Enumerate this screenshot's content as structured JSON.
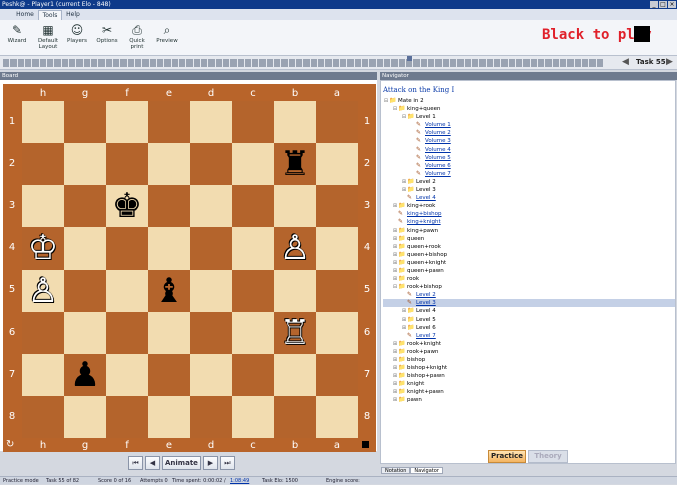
{
  "window": {
    "title": "Peshk@ - Player1 (current Elo - 848)"
  },
  "ribbon_tabs": [
    "Home",
    "Tools",
    "Help"
  ],
  "ribbon_buttons": [
    {
      "label": "Wizard",
      "icon": "wizard-icon"
    },
    {
      "label": "Default Layout",
      "icon": "default-layout-icon"
    },
    {
      "label": "Players",
      "icon": "players-icon"
    },
    {
      "label": "Options",
      "icon": "options-icon"
    },
    {
      "label": "Quick print",
      "icon": "quick-print-icon"
    },
    {
      "label": "Preview",
      "icon": "preview-icon"
    }
  ],
  "to_move": {
    "text": "Black to play",
    "color": "#000000"
  },
  "task": {
    "label": "Task 55"
  },
  "board": {
    "panel_title": "Board",
    "files": [
      "h",
      "g",
      "f",
      "e",
      "d",
      "c",
      "b",
      "a"
    ],
    "ranks": [
      "1",
      "2",
      "3",
      "4",
      "5",
      "6",
      "7",
      "8"
    ],
    "pieces": [
      {
        "square": "b2",
        "type": "rook",
        "color": "black",
        "glyph": "♜"
      },
      {
        "square": "f3",
        "type": "king",
        "color": "black",
        "glyph": "♚"
      },
      {
        "square": "h4",
        "type": "king",
        "color": "white",
        "glyph": "♔"
      },
      {
        "square": "b4",
        "type": "pawn",
        "color": "white",
        "glyph": "♙"
      },
      {
        "square": "h5",
        "type": "pawn",
        "color": "white",
        "glyph": "♙"
      },
      {
        "square": "e5",
        "type": "bishop",
        "color": "black",
        "glyph": "♝"
      },
      {
        "square": "b6",
        "type": "rook",
        "color": "white",
        "glyph": "♖"
      },
      {
        "square": "g7",
        "type": "pawn",
        "color": "black",
        "glyph": "♟"
      }
    ],
    "light_color": "#f2dcb0",
    "dark_color": "#b4642c",
    "controls": {
      "first": "⏮",
      "prev": "◀",
      "animate": "Animate",
      "next": "▶",
      "last": "⏭"
    }
  },
  "navigator": {
    "panel_title": "Navigator",
    "title": "Attack on the King I",
    "tree": [
      {
        "label": "Mate in 2",
        "depth": 0,
        "expander": "⊟",
        "icon": "folder"
      },
      {
        "label": "king+queen",
        "depth": 1,
        "expander": "⊟",
        "icon": "folder"
      },
      {
        "label": "Level 1",
        "depth": 2,
        "expander": "⊟",
        "icon": "folder"
      },
      {
        "label": "Volume 1",
        "depth": 3,
        "expander": "",
        "icon": "task",
        "link": true
      },
      {
        "label": "Volume 2",
        "depth": 3,
        "expander": "",
        "icon": "task",
        "link": true
      },
      {
        "label": "Volume 3",
        "depth": 3,
        "expander": "",
        "icon": "task",
        "link": true
      },
      {
        "label": "Volume 4",
        "depth": 3,
        "expander": "",
        "icon": "task",
        "link": true
      },
      {
        "label": "Volume 5",
        "depth": 3,
        "expander": "",
        "icon": "task",
        "link": true
      },
      {
        "label": "Volume 6",
        "depth": 3,
        "expander": "",
        "icon": "task",
        "link": true
      },
      {
        "label": "Volume 7",
        "depth": 3,
        "expander": "",
        "icon": "task",
        "link": true
      },
      {
        "label": "Level 2",
        "depth": 2,
        "expander": "⊞",
        "icon": "folder"
      },
      {
        "label": "Level 3",
        "depth": 2,
        "expander": "⊞",
        "icon": "folder"
      },
      {
        "label": "Level 4",
        "depth": 2,
        "expander": "",
        "icon": "task",
        "link": true
      },
      {
        "label": "king+rook",
        "depth": 1,
        "expander": "⊞",
        "icon": "folder"
      },
      {
        "label": "king+bishop",
        "depth": 1,
        "expander": "",
        "icon": "task",
        "link": true
      },
      {
        "label": "king+knight",
        "depth": 1,
        "expander": "",
        "icon": "task",
        "link": true
      },
      {
        "label": "king+pawn",
        "depth": 1,
        "expander": "⊞",
        "icon": "folder"
      },
      {
        "label": "queen",
        "depth": 1,
        "expander": "⊞",
        "icon": "folder"
      },
      {
        "label": "queen+rook",
        "depth": 1,
        "expander": "⊞",
        "icon": "folder"
      },
      {
        "label": "queen+bishop",
        "depth": 1,
        "expander": "⊞",
        "icon": "folder"
      },
      {
        "label": "queen+knight",
        "depth": 1,
        "expander": "⊞",
        "icon": "folder"
      },
      {
        "label": "queen+pawn",
        "depth": 1,
        "expander": "⊞",
        "icon": "folder"
      },
      {
        "label": "rook",
        "depth": 1,
        "expander": "⊞",
        "icon": "folder"
      },
      {
        "label": "rook+bishop",
        "depth": 1,
        "expander": "⊟",
        "icon": "folder"
      },
      {
        "label": "Level 2",
        "depth": 2,
        "expander": "",
        "icon": "task",
        "link": true
      },
      {
        "label": "Level 3",
        "depth": 2,
        "expander": "",
        "icon": "task",
        "link": true,
        "selected": true
      },
      {
        "label": "Level 4",
        "depth": 2,
        "expander": "⊞",
        "icon": "folder"
      },
      {
        "label": "Level 5",
        "depth": 2,
        "expander": "⊞",
        "icon": "folder"
      },
      {
        "label": "Level 6",
        "depth": 2,
        "expander": "⊞",
        "icon": "folder"
      },
      {
        "label": "Level 7",
        "depth": 2,
        "expander": "",
        "icon": "task",
        "link": true
      },
      {
        "label": "rook+knight",
        "depth": 1,
        "expander": "⊞",
        "icon": "folder"
      },
      {
        "label": "rook+pawn",
        "depth": 1,
        "expander": "⊞",
        "icon": "folder"
      },
      {
        "label": "bishop",
        "depth": 1,
        "expander": "⊞",
        "icon": "folder"
      },
      {
        "label": "bishop+knight",
        "depth": 1,
        "expander": "⊞",
        "icon": "folder"
      },
      {
        "label": "bishop+pawn",
        "depth": 1,
        "expander": "⊞",
        "icon": "folder"
      },
      {
        "label": "knight",
        "depth": 1,
        "expander": "⊞",
        "icon": "folder"
      },
      {
        "label": "knight+pawn",
        "depth": 1,
        "expander": "⊞",
        "icon": "folder"
      },
      {
        "label": "pawn",
        "depth": 1,
        "expander": "⊞",
        "icon": "folder"
      }
    ],
    "practice_label": "Practice",
    "theory_label": "Theory",
    "bottom_tabs": [
      "Notation",
      "Navigator"
    ]
  },
  "status": {
    "mode": "Practice mode",
    "task": "Task 55 of 82",
    "score": "Score 0 of 16",
    "attempts": "Attempts 0",
    "time": "Time spent: 0:00:02 /",
    "time_link": "1:08:49",
    "elo": "Task Elo: 1500",
    "engine": "Engine score:"
  },
  "colors": {
    "accent": "#e0202a",
    "practice": "#f4b460"
  }
}
